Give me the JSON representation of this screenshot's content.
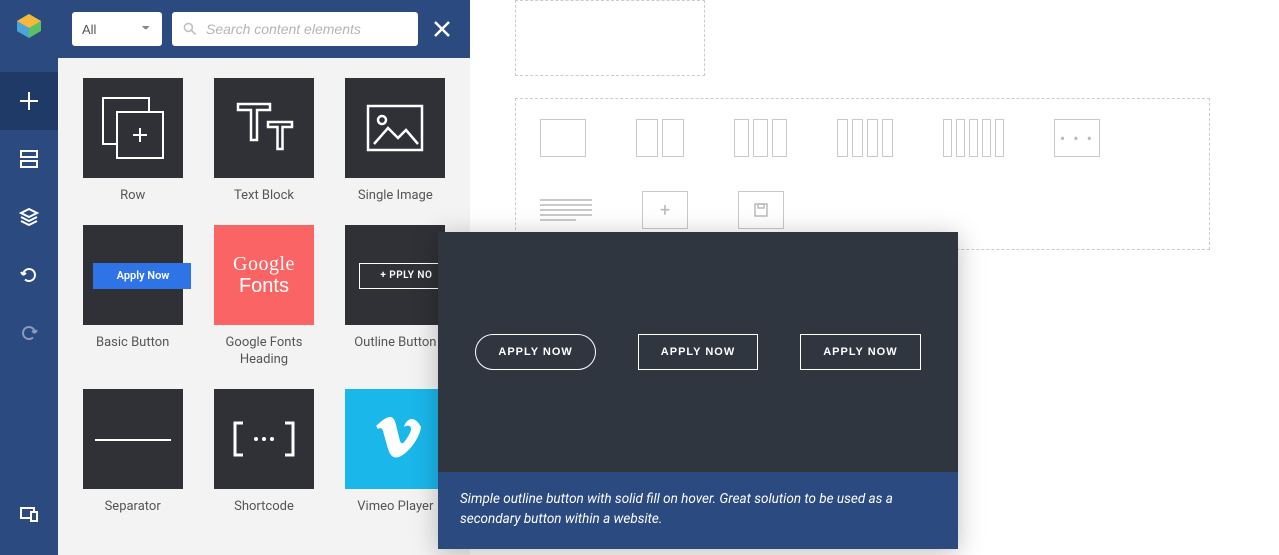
{
  "filter": {
    "value": "All"
  },
  "search": {
    "placeholder": "Search content elements"
  },
  "elements": {
    "row": "Row",
    "text_block": "Text Block",
    "single_image": "Single Image",
    "basic_button": "Basic Button",
    "gfonts_heading": "Google Fonts Heading",
    "outline_button": "Outline Button",
    "separator": "Separator",
    "shortcode": "Shortcode",
    "vimeo": "Vimeo Player"
  },
  "thumb": {
    "basic_button_label": "Apply Now",
    "gfonts_line1": "Google",
    "gfonts_line2": "Fonts",
    "outline_button_label": "PPLY NO"
  },
  "preview": {
    "btn1": "APPLY NOW",
    "btn2": "APPLY NOW",
    "btn3": "APPLY NOW",
    "description": "Simple outline button with solid fill on hover. Great solution to be used as a secondary button within a website."
  },
  "canvas": {
    "custom_dots": "• • •"
  }
}
